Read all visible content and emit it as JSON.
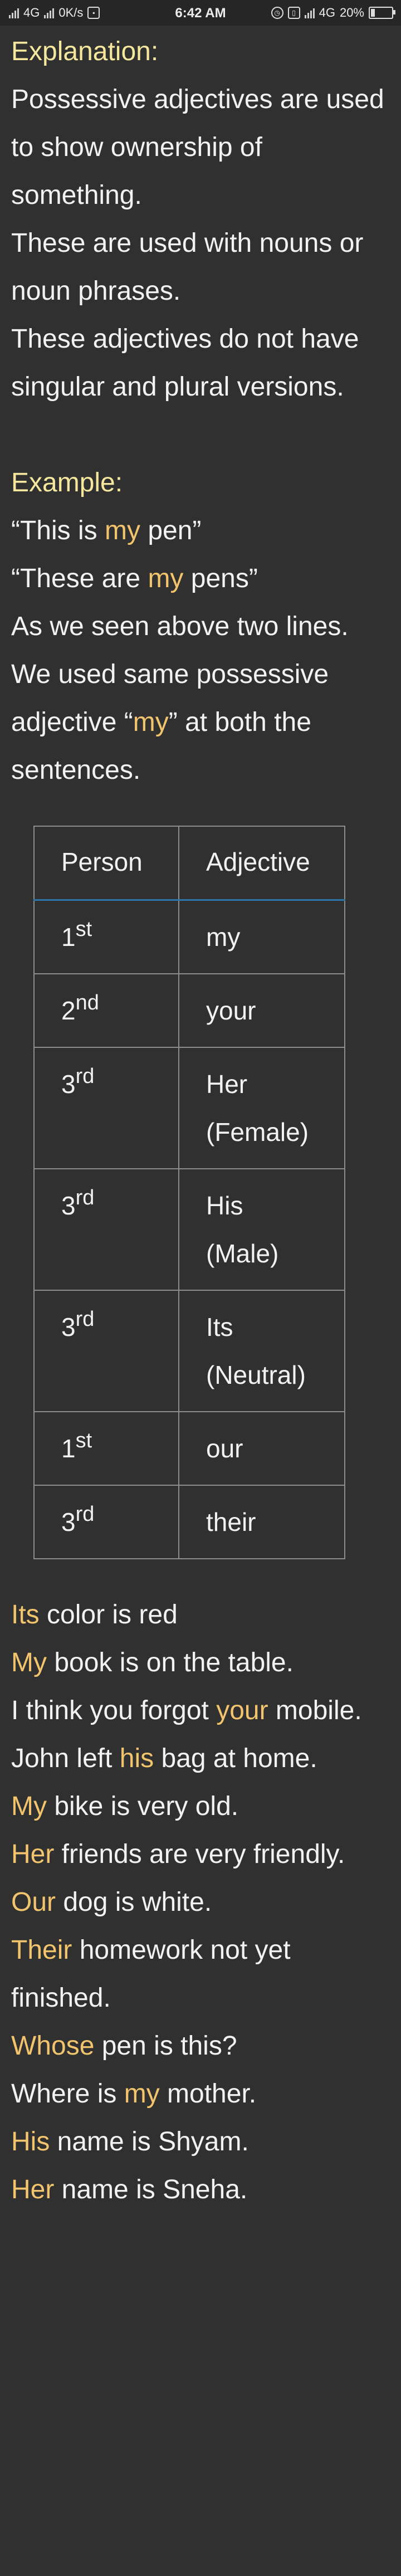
{
  "status_bar": {
    "network": "4G",
    "speed": "0K/s",
    "time": "6:42 AM",
    "right_network": "4G",
    "battery": "20%"
  },
  "explanation": {
    "heading": "Explanation:",
    "paragraphs": [
      "Possessive adjectives are used to show ownership of something.",
      "These are used with nouns or noun phrases.",
      "These  adjectives do not have singular and plural versions."
    ]
  },
  "example": {
    "heading": "Example:",
    "line1": {
      "pre": "“This is ",
      "hl": "my",
      "post": " pen”"
    },
    "line2": {
      "pre": "“These are ",
      "hl": "my",
      "post": " pens”"
    },
    "note": {
      "pre": "As we seen above two lines. We used same possessive adjective “",
      "hl": "my",
      "post": "” at both the sentences."
    }
  },
  "table": {
    "headers": [
      "Person",
      "Adjective"
    ],
    "rows": [
      {
        "num": "1",
        "sup": "st",
        "adj": "my"
      },
      {
        "num": "2",
        "sup": "nd",
        "adj": "your"
      },
      {
        "num": "3",
        "sup": "rd",
        "adj": "Her (Female)"
      },
      {
        "num": "3",
        "sup": "rd",
        "adj": "His (Male)"
      },
      {
        "num": "3",
        "sup": "rd",
        "adj": "Its (Neutral)"
      },
      {
        "num": "1",
        "sup": "st",
        "adj": "our"
      },
      {
        "num": "3",
        "sup": "rd",
        "adj": "their"
      }
    ]
  },
  "sentences": [
    {
      "pre": "",
      "hl": "Its",
      "post": " color is red"
    },
    {
      "pre": "",
      "hl": "My",
      "post": " book is on the table."
    },
    {
      "pre": "I think you forgot ",
      "hl": "your",
      "post": " mobile."
    },
    {
      "pre": "John left ",
      "hl": "his",
      "post": " bag at home."
    },
    {
      "pre": "",
      "hl": "My",
      "post": " bike is very old."
    },
    {
      "pre": "",
      "hl": "Her",
      "post": " friends are very friendly."
    },
    {
      "pre": "",
      "hl": "Our",
      "post": " dog is white."
    },
    {
      "pre": "",
      "hl": "Their",
      "post": " homework not yet finished."
    },
    {
      "pre": "",
      "hl": "Whose",
      "post": " pen is this?"
    },
    {
      "pre": "Where is ",
      "hl": "my",
      "post": " mother."
    },
    {
      "pre": "",
      "hl": "His",
      "post": " name is Shyam."
    },
    {
      "pre": "",
      "hl": "Her",
      "post": " name is Sneha."
    }
  ],
  "colors": {
    "background": "#303030",
    "heading": "#f5e79e",
    "highlight": "#f2c46d",
    "text": "#f2f2f2"
  }
}
